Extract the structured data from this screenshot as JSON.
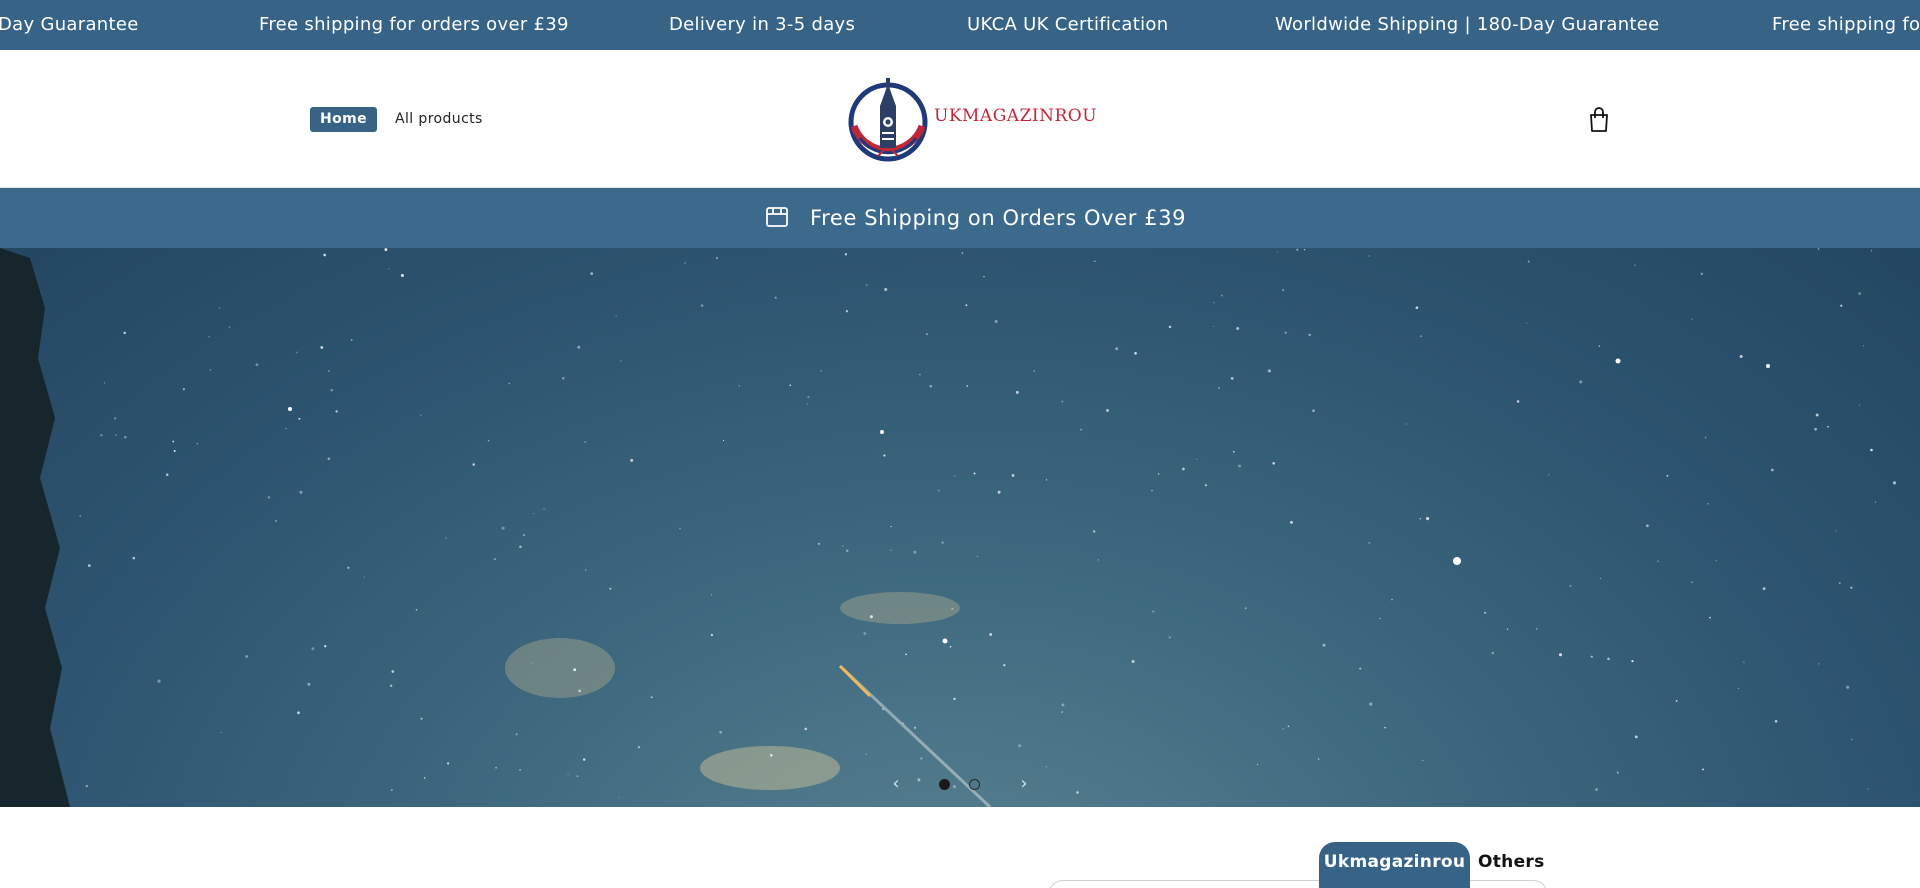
{
  "ticker": {
    "items": [
      "Day Guarantee",
      "Free shipping for orders over £39",
      "Delivery in 3-5 days",
      "UKCA UK Certification",
      "Worldwide Shipping | 180-Day Guarantee",
      "Free shipping for"
    ]
  },
  "header": {
    "nav": {
      "home": "Home",
      "all_products": "All products"
    },
    "logo_text": "UKMAGAZINROU",
    "cart_icon": "shopping-bag-icon"
  },
  "announcement": {
    "icon": "store-icon",
    "text": "Free Shipping on Orders Over £39"
  },
  "hero": {
    "prev": "‹",
    "next": "›",
    "slides_total": 2,
    "active_slide": 1
  },
  "tabs": {
    "active": "Ukmagazinrou",
    "other": "Others"
  },
  "colors": {
    "brand": "#376486",
    "logo_red": "#c0283a",
    "logo_navy": "#1f3a7a"
  }
}
